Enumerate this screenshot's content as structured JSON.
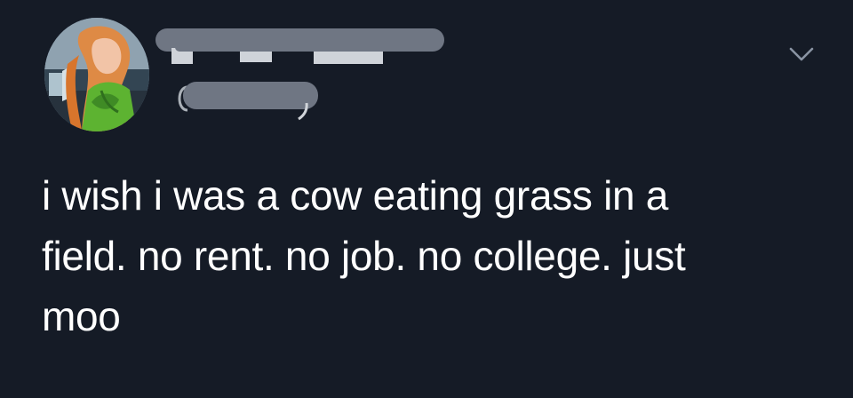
{
  "tweet": {
    "avatar_icon": "user-avatar-icon",
    "menu_icon": "chevron-down-icon",
    "text_lines": [
      "i wish i was a cow eating grass in a",
      "field. no rent. no job. no college. just",
      "moo"
    ]
  },
  "colors": {
    "background": "#151b26",
    "text": "#ffffff",
    "redaction": "#6f7683",
    "chevron": "#8a94a3"
  }
}
